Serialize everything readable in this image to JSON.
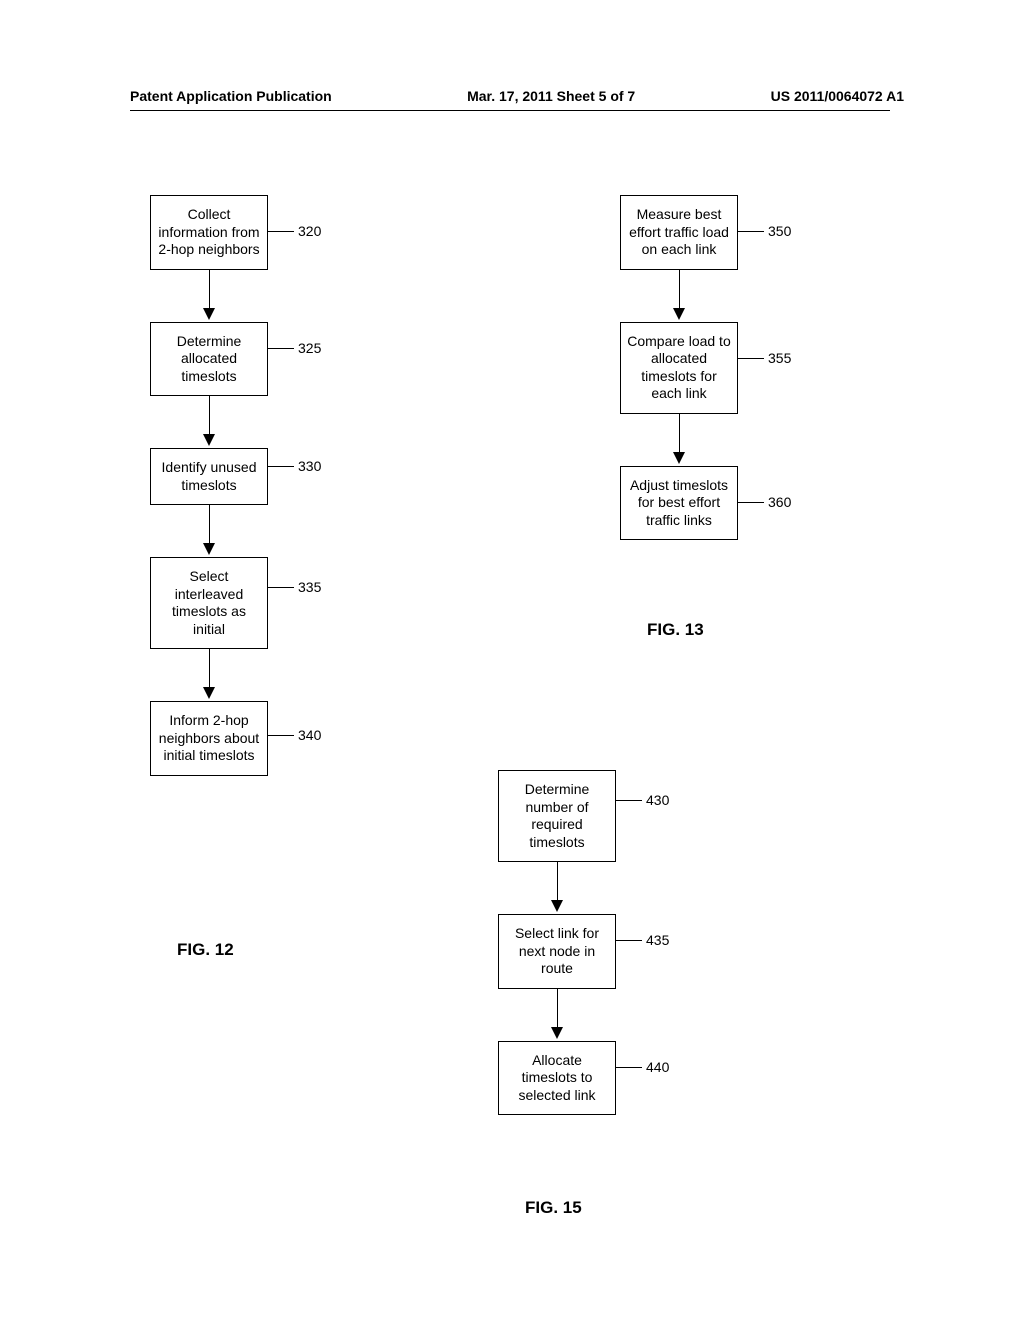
{
  "header": {
    "left": "Patent Application Publication",
    "center": "Mar. 17, 2011  Sheet 5 of 7",
    "right": "US 2011/0064072 A1"
  },
  "fig12": {
    "caption": "FIG. 12",
    "steps": [
      {
        "ref": "320",
        "text": "Collect information from 2-hop neighbors"
      },
      {
        "ref": "325",
        "text": "Determine allocated timeslots"
      },
      {
        "ref": "330",
        "text": "Identify unused timeslots"
      },
      {
        "ref": "335",
        "text": "Select interleaved timeslots as initial"
      },
      {
        "ref": "340",
        "text": "Inform 2-hop neighbors about initial timeslots"
      }
    ]
  },
  "fig13": {
    "caption": "FIG. 13",
    "steps": [
      {
        "ref": "350",
        "text": "Measure best effort traffic load on each link"
      },
      {
        "ref": "355",
        "text": "Compare load to allocated timeslots for each link"
      },
      {
        "ref": "360",
        "text": "Adjust timeslots for best effort traffic links"
      }
    ]
  },
  "fig15": {
    "caption": "FIG. 15",
    "steps": [
      {
        "ref": "430",
        "text": "Determine number of required timeslots"
      },
      {
        "ref": "435",
        "text": "Select link for next node in route"
      },
      {
        "ref": "440",
        "text": "Allocate timeslots to selected link"
      }
    ]
  }
}
